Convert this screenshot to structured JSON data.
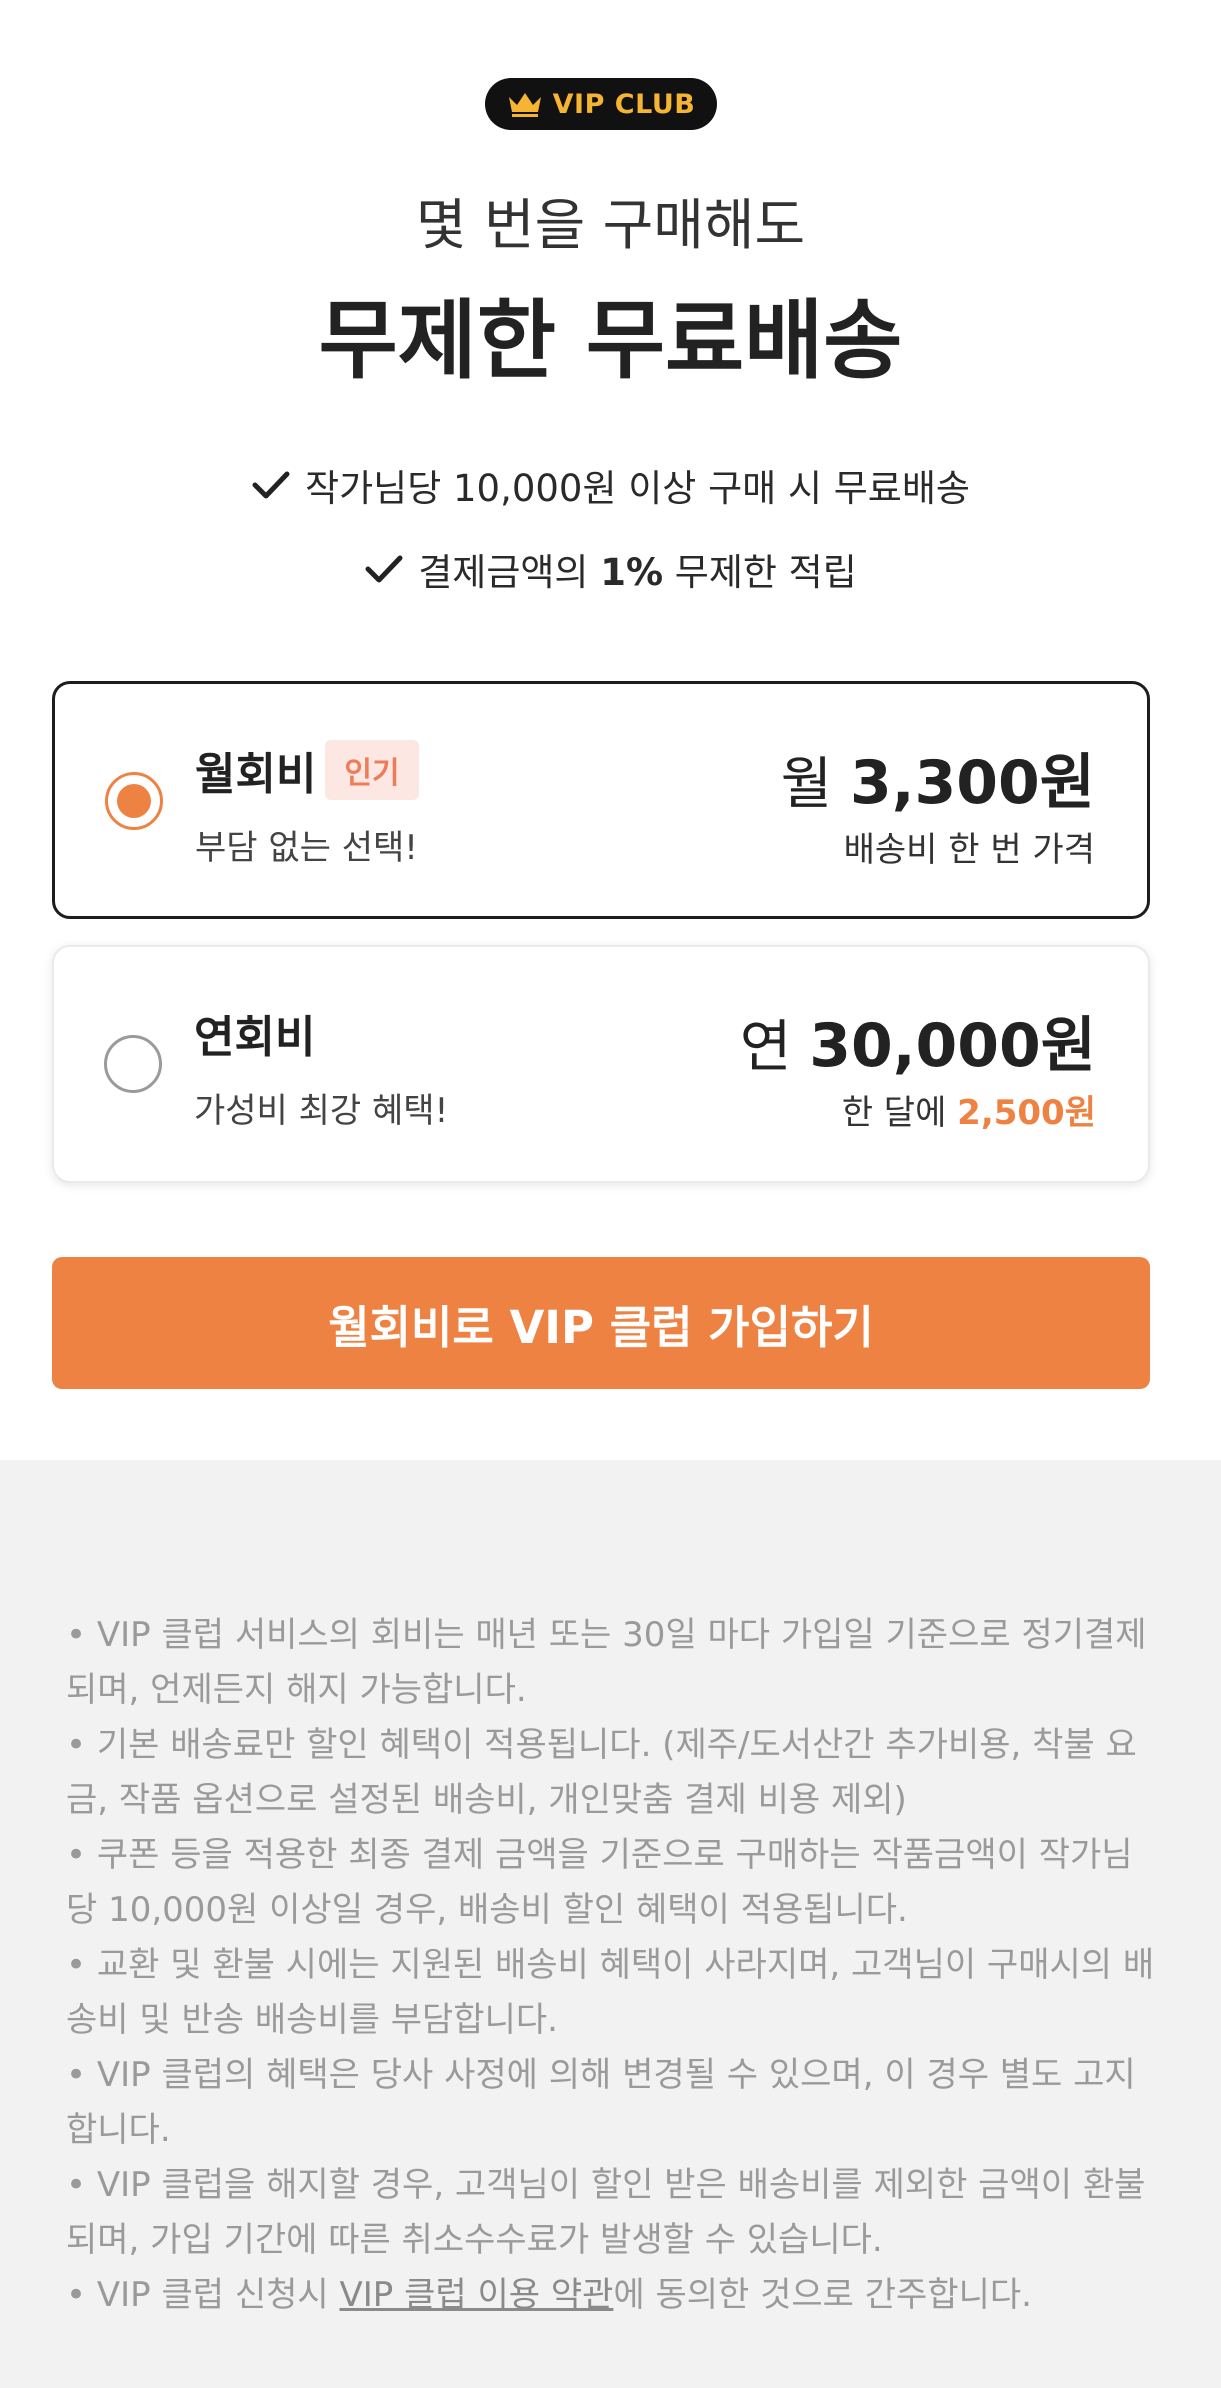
{
  "badge": {
    "icon": "crown-icon",
    "label": "VIP CLUB"
  },
  "header": {
    "subtitle": "몇 번을 구매해도",
    "title": "무제한 무료배송"
  },
  "benefits": [
    {
      "icon": "check-icon",
      "prefix": "작가님당 10,000원 이상 구매 시 무료배송",
      "highlight": "",
      "suffix": ""
    },
    {
      "icon": "check-icon",
      "prefix": "결제금액의 ",
      "highlight": "1%",
      "suffix": " 무제한 적립"
    }
  ],
  "plans": [
    {
      "name": "월회비",
      "tag": "인기",
      "description": "부담 없는 선택!",
      "price_prefix": "월 ",
      "price_amount": "3,300",
      "price_unit": "원",
      "sub_prefix": "배송비 한 번 가격",
      "sub_accent": "",
      "selected": true
    },
    {
      "name": "연회비",
      "tag": "",
      "description": "가성비 최강 혜택!",
      "price_prefix": "연 ",
      "price_amount": "30,000",
      "price_unit": "원",
      "sub_prefix": "한 달에 ",
      "sub_accent": "2,500원",
      "selected": false
    }
  ],
  "cta": {
    "label": "월회비로 VIP 클럽 가입하기"
  },
  "notices": [
    "• VIP 클럽 서비스의 회비는 매년 또는 30일 마다 가입일 기준으로 정기결제되며, 언제든지 해지 가능합니다.",
    "• 기본 배송료만 할인 혜택이 적용됩니다. (제주/도서산간 추가비용, 착불 요금, 작품 옵션으로 설정된 배송비, 개인맞춤 결제 비용 제외)",
    "• 쿠폰 등을 적용한 최종 결제 금액을 기준으로 구매하는 작품금액이 작가님당 10,000원 이상일 경우, 배송비 할인 혜택이 적용됩니다.",
    "• 교환 및 환불 시에는 지원된 배송비 혜택이 사라지며, 고객님이 구매시의 배송비 및 반송 배송비를 부담합니다.",
    "• VIP 클럽의 혜택은 당사 사정에 의해 변경될 수 있으며, 이 경우 별도 고지합니다.",
    "• VIP 클럽을 해지할 경우, 고객님이 할인 받은 배송비를 제외한 금액이 환불되며, 가입 기간에 따른 취소수수료가 발생할 수 있습니다."
  ],
  "last_notice": {
    "prefix": "• VIP 클럽 신청시 ",
    "link": "VIP 클럽 이용 약관",
    "suffix": "에 동의한 것으로 간주합니다."
  },
  "colors": {
    "accent": "#ee8242",
    "badge_bg": "#111111",
    "badge_text": "#f5b532",
    "tag_bg": "#fde7e2",
    "tag_text": "#ef7b58",
    "notice_bg": "#f2f2f2",
    "notice_text": "#9a9a9a"
  }
}
